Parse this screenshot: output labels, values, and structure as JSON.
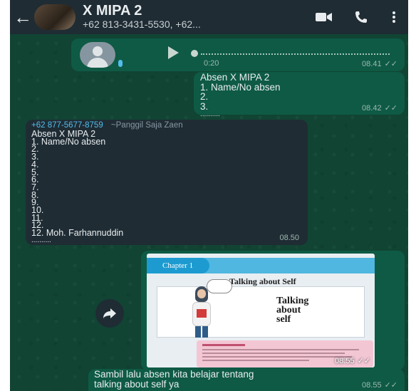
{
  "header": {
    "back_icon": "arrow-left-icon",
    "title": "X MIPA 2",
    "subtitle": "+62 813-3431-5530, +62..."
  },
  "voice_message": {
    "duration": "0:20",
    "time": "08.41"
  },
  "msg_out_1": {
    "lines": [
      "Absen X MIPA 2",
      "1. Name/No absen",
      "2.",
      "3.",
      ".........."
    ],
    "time": "08.42"
  },
  "msg_in_1": {
    "sender_number": "+62 877-5677-8759",
    "sender_name": "~Panggil Saja Zaen",
    "lines": [
      "Absen X MIPA 2",
      "1. Name/No absen",
      "2.",
      "3.",
      "4.",
      "5.",
      "6.",
      "7.",
      "8.",
      "9.",
      "10.",
      "11.",
      "12.",
      "12. Moh. Farhannuddin",
      ".........."
    ],
    "time": "08.50"
  },
  "image_msg": {
    "chapter_label": "Chapter 1",
    "heading": "Talking about Self",
    "cover_text": [
      "Talking",
      "about",
      "self"
    ],
    "time": "08.55"
  },
  "msg_out_2": {
    "lines": [
      "Sambil lalu absen kita belajar tentang",
      "talking about self ya"
    ],
    "time": "08.55"
  },
  "colors": {
    "header": "#1f2c34",
    "outgoing": "#0e5a45",
    "incoming": "#1f2c34",
    "wallpaper": "#114433",
    "sender_number": "#53bdeb",
    "tick": "#9fb8ad"
  }
}
